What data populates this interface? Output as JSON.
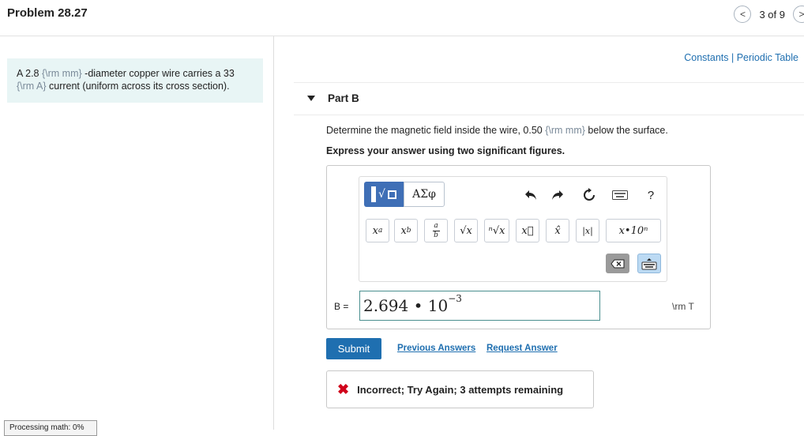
{
  "header": {
    "problem_title": "Problem 28.27",
    "prev_label": "<",
    "page_count": "3 of 9",
    "next_label": ">"
  },
  "problem": {
    "text_1": "A 2.8 ",
    "tex_1": "{\\rm mm}",
    "text_2": " -diameter copper wire carries a 33 ",
    "tex_2": "{\\rm A}",
    "text_3": " current (uniform across its cross section)."
  },
  "processing_status": "Processing math: 0%",
  "resources": {
    "constants": "Constants",
    "separator": " | ",
    "periodic_table": "Periodic Table"
  },
  "part": {
    "title": "Part B",
    "question_1": "Determine the magnetic field inside the wire, 0.50 ",
    "question_tex": "{\\rm mm}",
    "question_2": " below the surface.",
    "instruction": "Express your answer using two significant figures."
  },
  "toolbar": {
    "greek_label": "ΑΣφ",
    "help_label": "?",
    "buttons": {
      "superscript": "x",
      "superscript_sup": "a",
      "subscript": "x",
      "subscript_sub": "b",
      "fraction_top": "a",
      "fraction_bottom": "b",
      "sqrt": "√x",
      "nthroot": "ⁿ√x",
      "vector": "x⃗",
      "hat": "x̂",
      "abs": "|x|",
      "sci": "x•10ⁿ"
    }
  },
  "answer": {
    "label": "B =",
    "mantissa": "2.694 • 10",
    "exponent": "−3",
    "unit": "\\rm T"
  },
  "actions": {
    "submit": "Submit",
    "previous_answers": "Previous Answers",
    "request_answer": "Request Answer"
  },
  "feedback": {
    "icon": "✖",
    "message": "Incorrect; Try Again; 3 attempts remaining"
  },
  "colors": {
    "accent": "#1f6fb0",
    "template_button": "#3f6fb6",
    "problem_bg": "#e8f5f5",
    "error": "#d0021b"
  }
}
